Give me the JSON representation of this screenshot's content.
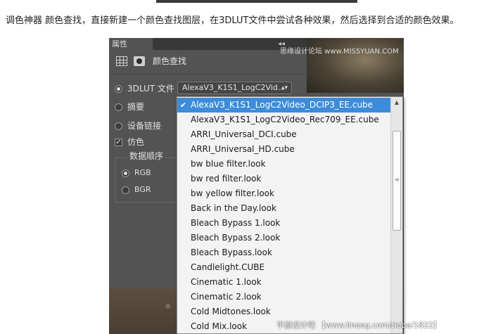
{
  "caption": "调色神器 颜色查找，直接新建一个颜色查找图层，在3DLUT文件中尝试各种效果，然后选择到合适的颜色效果。",
  "panel": {
    "tab_label": "属性",
    "title": "颜色查找",
    "options": {
      "lut_file_label": "3DLUT 文件",
      "abstract_label": "摘要",
      "device_link_label": "设备链接",
      "dither_label": "仿色",
      "data_order_label": "数据顺序",
      "rgb_label": "RGB",
      "bgr_label": "BGR"
    },
    "lut_select_value": "AlexaV3_K1S1_LogC2Vid..."
  },
  "dropdown": {
    "items": [
      "AlexaV3_K1S1_LogC2Video_DCIP3_EE.cube",
      "AlexaV3_K1S1_LogC2Video_Rec709_EE.cube",
      "ARRI_Universal_DCI.cube",
      "ARRI_Universal_HD.cube",
      "bw blue filter.look",
      "bw red filter.look",
      "bw yellow filter.look",
      "Back in the Day.look",
      "Bleach Bypass 1.look",
      "Bleach Bypass 2.look",
      "Bleach Bypass.look",
      "Candlelight.CUBE",
      "Cinematic 1.look",
      "Cinematic 2.look",
      "Cold Midtones.look",
      "Cold Mix.look"
    ],
    "selected_index": 0
  },
  "watermarks": {
    "top": "思缘设计论坛 www.MISSYUAN.COM",
    "bottom": "平面设计吧 【www.lineeg.com/tieba/1822】"
  },
  "colors": {
    "panel_bg": "#535353",
    "selection": "#3c8cda"
  }
}
